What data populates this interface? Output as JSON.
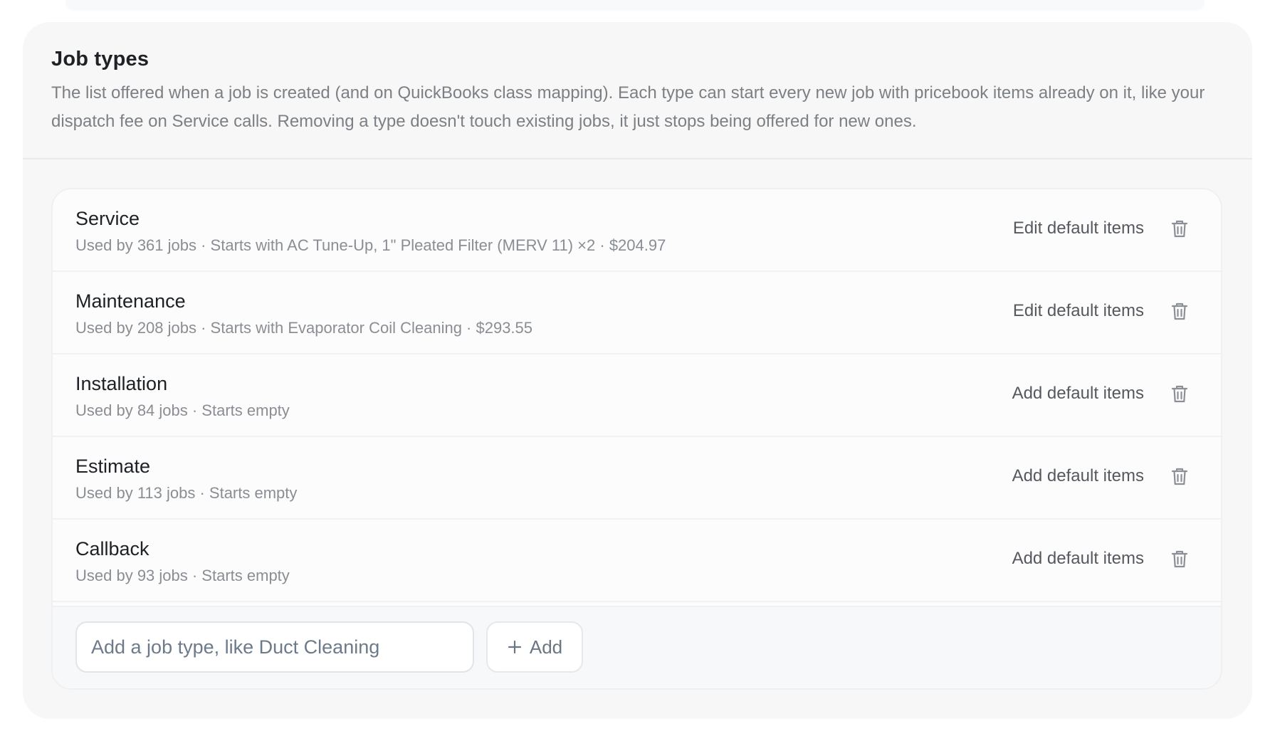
{
  "section": {
    "title": "Job types",
    "description": "The list offered when a job is created (and on QuickBooks class mapping). Each type can start every new job with pricebook items already on it, like your dispatch fee on Service calls. Removing a type doesn't touch existing jobs, it just stops being offered for new ones."
  },
  "job_types": [
    {
      "name": "Service",
      "meta": "Used by 361 jobs · Starts with AC Tune-Up, 1\" Pleated Filter (MERV 11) ×2 · $204.97",
      "action_label": "Edit default items",
      "delete_icon": "trash-icon"
    },
    {
      "name": "Maintenance",
      "meta": "Used by 208 jobs · Starts with Evaporator Coil Cleaning · $293.55",
      "action_label": "Edit default items",
      "delete_icon": "trash-icon"
    },
    {
      "name": "Installation",
      "meta": "Used by 84 jobs · Starts empty",
      "action_label": "Add default items",
      "delete_icon": "trash-icon"
    },
    {
      "name": "Estimate",
      "meta": "Used by 113 jobs · Starts empty",
      "action_label": "Add default items",
      "delete_icon": "trash-icon"
    },
    {
      "name": "Callback",
      "meta": "Used by 93 jobs · Starts empty",
      "action_label": "Add default items",
      "delete_icon": "trash-icon"
    }
  ],
  "add_form": {
    "input_value": "",
    "input_placeholder": "Add a job type, like Duct Cleaning",
    "button_label": "Add",
    "button_icon": "plus-icon"
  },
  "colors": {
    "section_background": "#f7f7f7",
    "card_background": "#fcfcfd",
    "title_text": "#1e2125",
    "muted_text": "#8a8e93",
    "action_text": "#55595e",
    "placeholder_text": "#6c7a8a"
  }
}
